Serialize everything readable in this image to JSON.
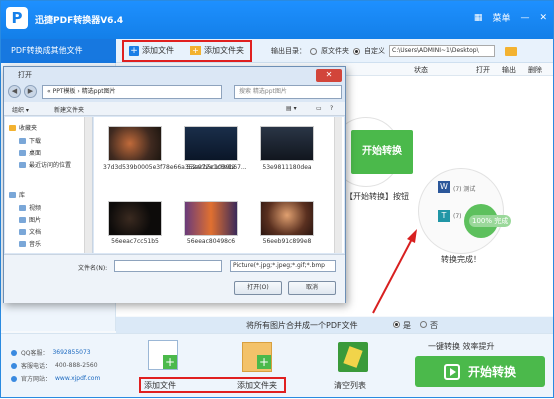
{
  "app": {
    "title": "迅捷PDF转换器V6.4",
    "menu_label": "菜单"
  },
  "toolbar": {
    "side_heading": "PDF转换成其他文件",
    "add_file": "添加文件",
    "add_folder": "添加文件夹",
    "output_dir_label": "输出目录：",
    "opt_original": "原文件夹",
    "opt_custom": "自定义",
    "output_path": "C:\\Users\\ADMINI~1\\Desktop\\"
  },
  "columns": {
    "status": "状态",
    "open": "打开",
    "output": "输出",
    "delete": "删除"
  },
  "main": {
    "start_convert": "开始转换",
    "hint": "【开始转换】按钮",
    "word_label": "(7) 测试",
    "tag_label": "(7)",
    "percent": "100%",
    "percent_suffix": "完成",
    "done": "转换完成！"
  },
  "merge": {
    "label": "将所有图片合并成一个PDF文件",
    "yes": "是",
    "no": "否"
  },
  "bottom": {
    "qq_label": "QQ客服：",
    "qq_value": "3692855073",
    "phone_label": "客服电话：",
    "phone_value": "400-888-2560",
    "site_label": "官方网站：",
    "site_value": "www.xjpdf.com",
    "add_file": "添加文件",
    "add_folder": "添加文件夹",
    "clear": "清空列表",
    "slogan": "一键转换  效率提升",
    "start": "开始转换"
  },
  "dialog": {
    "title": "打开",
    "address": "« PPT模板 › 精选ppt图片",
    "search_placeholder": "搜索 精选ppt图片",
    "organize": "组织 ▾",
    "new_folder": "新建文件夹",
    "nav": [
      "收藏夹",
      "下载",
      "桌面",
      "最近访问的位置",
      "库",
      "视频",
      "图片",
      "文档",
      "音乐"
    ],
    "files": [
      "37d3d539b0005e3f78e66a352acb5c1039b67...",
      "53e972e1c8e12",
      "53e9811180dea",
      "56eeac7cc51b5",
      "56eeac80498c6",
      "56eeb91c899e8"
    ],
    "filename_label": "文件名(N):",
    "filetype": "Picture(*.jpg;*.jpeg;*.gif;*.bmp",
    "open_button": "打开(O)",
    "cancel_button": "取消"
  },
  "colors": {
    "brand_blue": "#1680ea",
    "accent_green": "#4bb94b",
    "highlight_red": "#e02020"
  }
}
